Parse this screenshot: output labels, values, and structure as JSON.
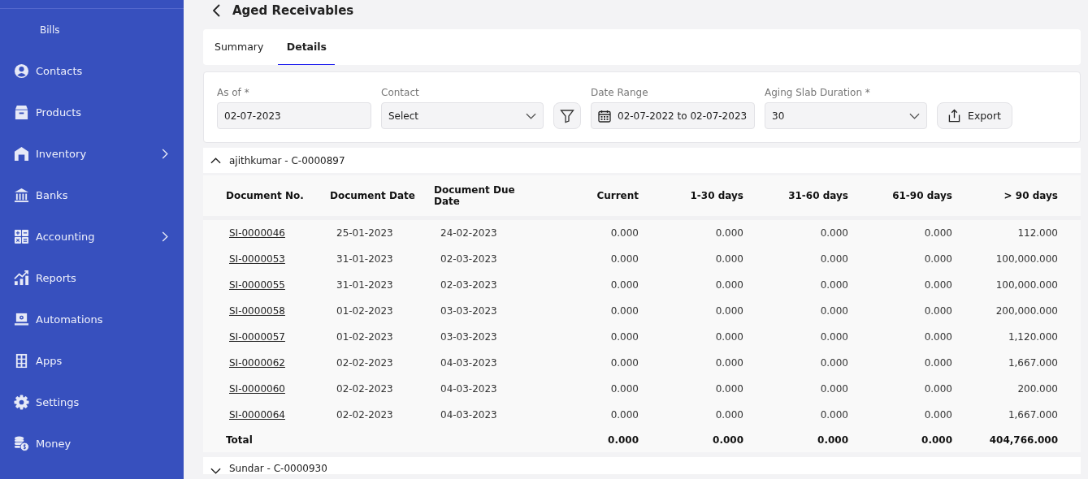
{
  "sidebar": {
    "items": [
      {
        "label": "Bills",
        "kind": "subitem",
        "expandable": false
      },
      {
        "label": "Contacts",
        "kind": "item",
        "expandable": false
      },
      {
        "label": "Products",
        "kind": "item",
        "expandable": false
      },
      {
        "label": "Inventory",
        "kind": "item",
        "expandable": true
      },
      {
        "label": "Banks",
        "kind": "item",
        "expandable": false
      },
      {
        "label": "Accounting",
        "kind": "item",
        "expandable": true
      },
      {
        "label": "Reports",
        "kind": "item",
        "expandable": false
      },
      {
        "label": "Automations",
        "kind": "item",
        "expandable": false
      },
      {
        "label": "Apps",
        "kind": "item",
        "expandable": false
      },
      {
        "label": "Settings",
        "kind": "item",
        "expandable": false
      },
      {
        "label": "Money",
        "kind": "item",
        "expandable": false
      }
    ]
  },
  "page": {
    "title": "Aged Receivables"
  },
  "tabs": [
    {
      "label": "Summary",
      "selected": false
    },
    {
      "label": "Details",
      "selected": true
    }
  ],
  "filters": {
    "as_of": {
      "label": "As of *",
      "value": "02-07-2023"
    },
    "contact": {
      "label": "Contact",
      "value": "Select"
    },
    "date_range": {
      "label": "Date Range",
      "value": "02-07-2022 to 02-07-2023"
    },
    "aging_slab": {
      "label": "Aging Slab Duration *",
      "value": "30"
    },
    "export_button": "Export"
  },
  "groups": [
    {
      "title": "ajithkumar - C-0000897",
      "expanded": true,
      "columns": [
        "Document No.",
        "Document Date",
        "Document Due Date",
        "Current",
        "1-30 days",
        "31-60 days",
        "61-90 days",
        "> 90 days"
      ],
      "rows": [
        [
          "SI-0000046",
          "25-01-2023",
          "24-02-2023",
          "0.000",
          "0.000",
          "0.000",
          "0.000",
          "112.000"
        ],
        [
          "SI-0000053",
          "31-01-2023",
          "02-03-2023",
          "0.000",
          "0.000",
          "0.000",
          "0.000",
          "100,000.000"
        ],
        [
          "SI-0000055",
          "31-01-2023",
          "02-03-2023",
          "0.000",
          "0.000",
          "0.000",
          "0.000",
          "100,000.000"
        ],
        [
          "SI-0000058",
          "01-02-2023",
          "03-03-2023",
          "0.000",
          "0.000",
          "0.000",
          "0.000",
          "200,000.000"
        ],
        [
          "SI-0000057",
          "01-02-2023",
          "03-03-2023",
          "0.000",
          "0.000",
          "0.000",
          "0.000",
          "1,120.000"
        ],
        [
          "SI-0000062",
          "02-02-2023",
          "04-03-2023",
          "0.000",
          "0.000",
          "0.000",
          "0.000",
          "1,667.000"
        ],
        [
          "SI-0000060",
          "02-02-2023",
          "04-03-2023",
          "0.000",
          "0.000",
          "0.000",
          "0.000",
          "200.000"
        ],
        [
          "SI-0000064",
          "02-02-2023",
          "04-03-2023",
          "0.000",
          "0.000",
          "0.000",
          "0.000",
          "1,667.000"
        ]
      ],
      "total": {
        "label": "Total",
        "values": [
          "0.000",
          "0.000",
          "0.000",
          "0.000",
          "404,766.000"
        ]
      }
    },
    {
      "title": "Sundar - C-0000930",
      "expanded": false
    }
  ]
}
